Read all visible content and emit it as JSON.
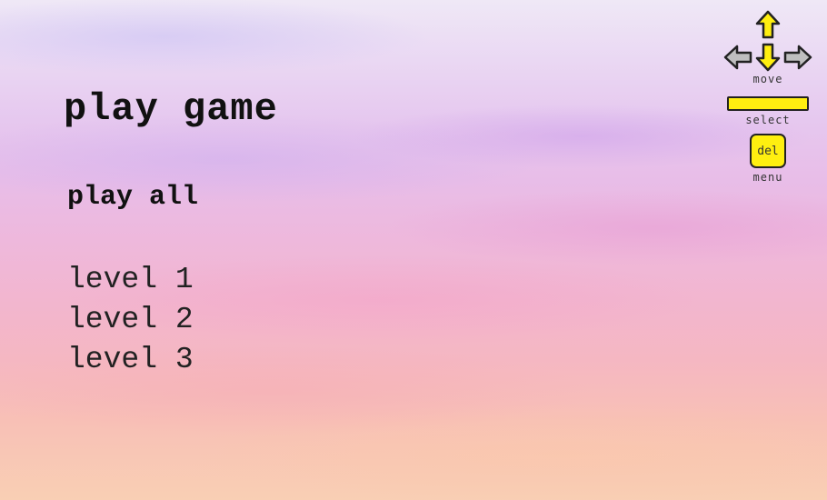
{
  "menu": {
    "title": "play game",
    "play_all": "play all",
    "levels": [
      "level 1",
      "level 2",
      "level 3"
    ]
  },
  "controls": {
    "move_label": "move",
    "select_label": "select",
    "del_key": "del",
    "menu_label": "menu",
    "key_color": "#ffef10",
    "arrow_gray": "#bfbfbf"
  }
}
